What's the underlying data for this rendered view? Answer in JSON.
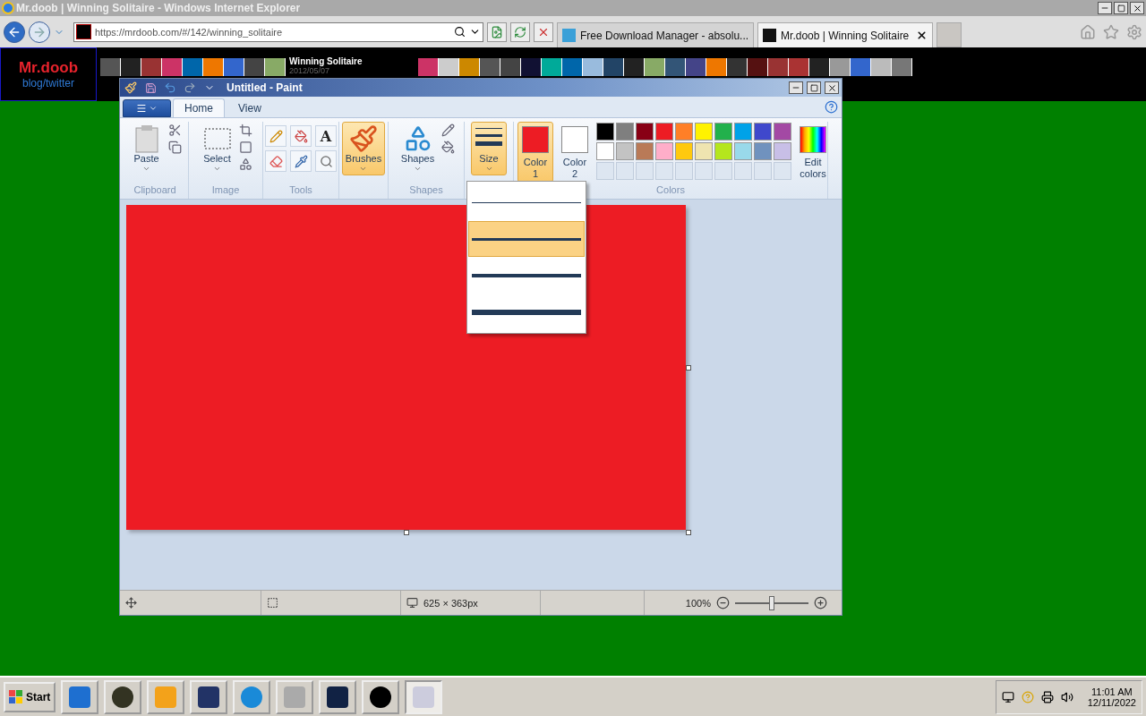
{
  "ie": {
    "title": "Mr.doob | Winning Solitaire - Windows Internet Explorer",
    "address": "https://mrdoob.com/#/142/winning_solitaire",
    "tabs": [
      {
        "label": "Free Download Manager - absolu...",
        "selected": false
      },
      {
        "label": "Mr.doob | Winning Solitaire",
        "selected": true
      }
    ]
  },
  "site": {
    "logo_title": "Mr.doob",
    "logo_subtitle": "blog/twitter",
    "featured_title": "Winning Solitaire",
    "featured_date": "2012/05/07"
  },
  "paint": {
    "title": "Untitled - Paint",
    "tabs": [
      {
        "label": "Home",
        "selected": true
      },
      {
        "label": "View",
        "selected": false
      }
    ],
    "clipboard": {
      "paste": "Paste",
      "group": "Clipboard"
    },
    "image": {
      "select": "Select",
      "group": "Image"
    },
    "tools": {
      "text_glyph": "A",
      "group": "Tools"
    },
    "brushes": {
      "label": "Brushes",
      "selected": true
    },
    "shapes": {
      "label": "Shapes",
      "group": "Shapes"
    },
    "size": {
      "label": "Size",
      "expanded": true,
      "options": [
        {
          "selected": false
        },
        {
          "selected": true
        },
        {
          "selected": false
        },
        {
          "selected": false
        }
      ]
    },
    "color1": {
      "label": "Color",
      "number": "1",
      "selected": true,
      "color": "#ed1c24"
    },
    "color2": {
      "label": "Color",
      "number": "2",
      "selected": false,
      "color": "#ffffff"
    },
    "palette": [
      {
        "kind": "swatch",
        "color": "#000000"
      },
      {
        "kind": "swatch",
        "color": "#7f7f7f"
      },
      {
        "kind": "swatch",
        "color": "#880015"
      },
      {
        "kind": "swatch",
        "color": "#ed1c24"
      },
      {
        "kind": "swatch",
        "color": "#ff7f27"
      },
      {
        "kind": "swatch",
        "color": "#fff200"
      },
      {
        "kind": "swatch",
        "color": "#22b14c"
      },
      {
        "kind": "swatch",
        "color": "#00a2e8"
      },
      {
        "kind": "swatch",
        "color": "#3f48cc"
      },
      {
        "kind": "swatch",
        "color": "#a349a4"
      },
      {
        "kind": "swatch",
        "color": "#ffffff"
      },
      {
        "kind": "swatch",
        "color": "#c3c3c3"
      },
      {
        "kind": "swatch",
        "color": "#b97a57"
      },
      {
        "kind": "swatch",
        "color": "#ffaec9"
      },
      {
        "kind": "swatch",
        "color": "#ffc90e"
      },
      {
        "kind": "swatch",
        "color": "#efe4b0"
      },
      {
        "kind": "swatch",
        "color": "#b5e61d"
      },
      {
        "kind": "swatch",
        "color": "#99d9ea"
      },
      {
        "kind": "swatch",
        "color": "#7092be"
      },
      {
        "kind": "swatch",
        "color": "#c8bfe7"
      },
      {
        "kind": "empty"
      },
      {
        "kind": "empty"
      },
      {
        "kind": "empty"
      },
      {
        "kind": "empty"
      },
      {
        "kind": "empty"
      },
      {
        "kind": "empty"
      },
      {
        "kind": "empty"
      },
      {
        "kind": "empty"
      },
      {
        "kind": "empty"
      },
      {
        "kind": "empty"
      }
    ],
    "edit_colors": "Edit colors",
    "colors_group": "Colors",
    "status": {
      "dimensions": "625 × 363px",
      "zoom": "100%",
      "level": 0.5
    }
  },
  "taskbar": {
    "start": "Start",
    "apps": [
      {
        "selected": false
      },
      {
        "selected": false
      },
      {
        "selected": false
      },
      {
        "selected": false
      },
      {
        "selected": false
      },
      {
        "selected": false
      },
      {
        "selected": false
      },
      {
        "selected": false
      },
      {
        "selected": true
      }
    ],
    "time": "11:01 AM",
    "date": "12/11/2022"
  }
}
